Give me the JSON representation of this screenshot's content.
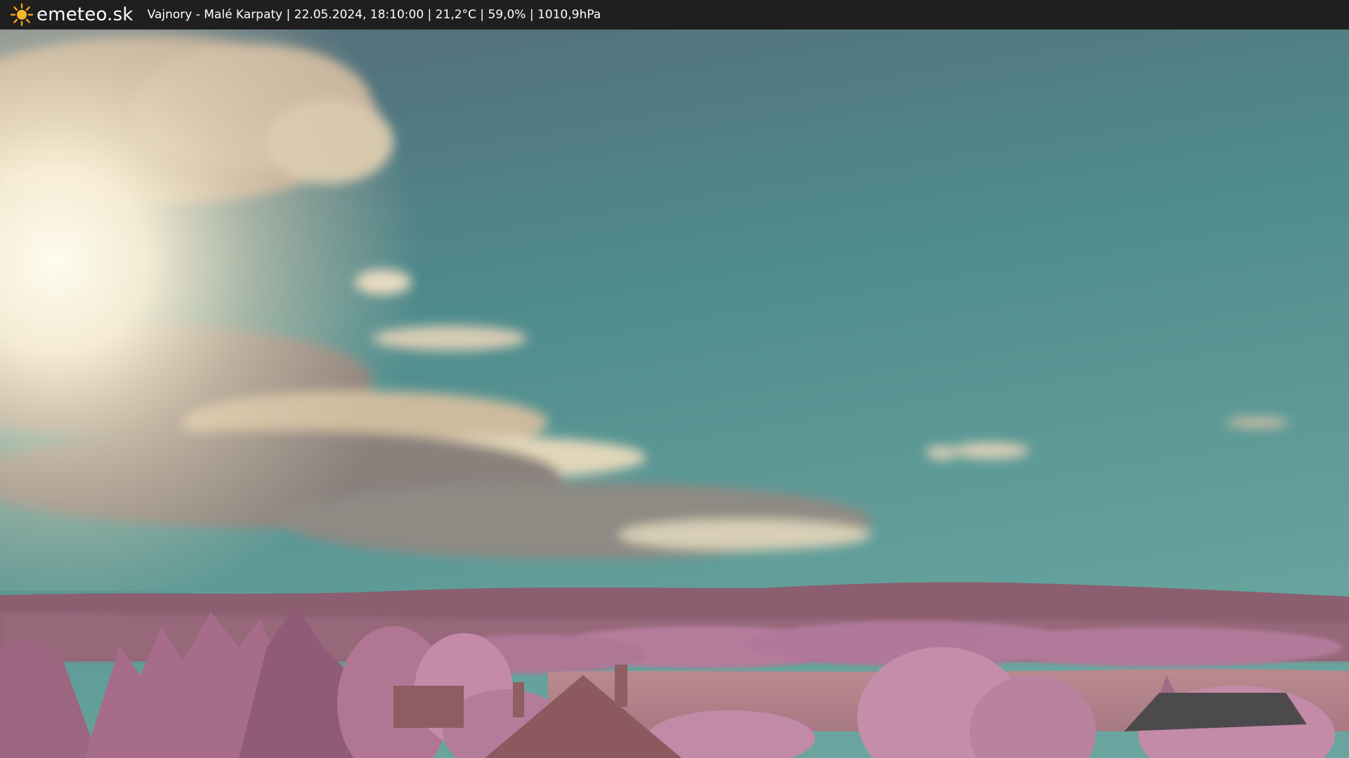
{
  "header": {
    "logo_icon": "sun-icon",
    "brand": "emeteo.sk",
    "info": "Vajnory - Malé Karpaty | 22.05.2024, 18:10:00 | 21,2°C | 59,0% | 1010,9hPa"
  },
  "colors": {
    "bar": "#1f1f1f",
    "sky_top": "#4f6572",
    "sky_mid": "#4e8e8c",
    "sky_low": "#5f9f9a",
    "foliage": "#b77c9c",
    "hills": "#8a5e70"
  }
}
